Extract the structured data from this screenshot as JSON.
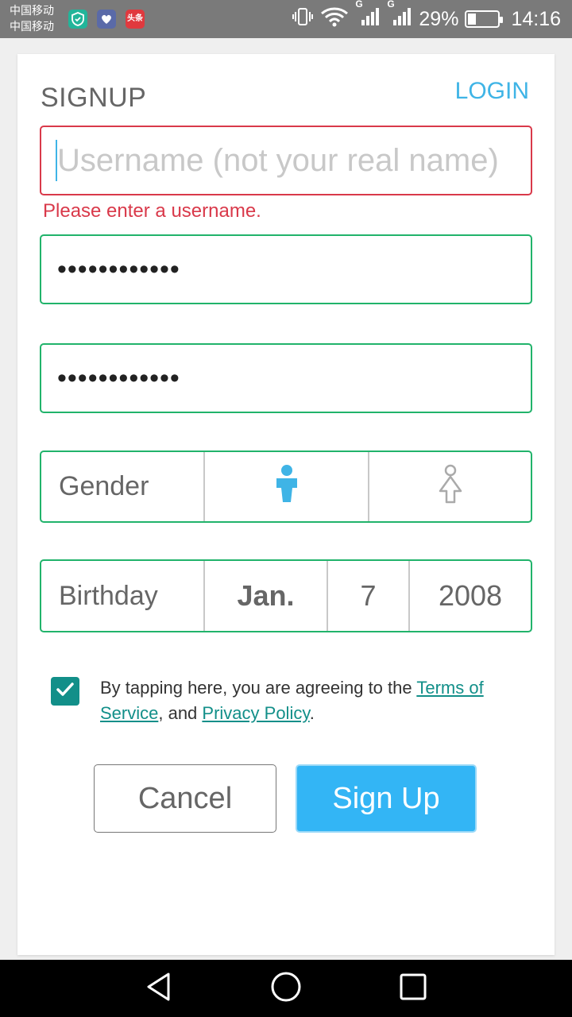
{
  "status_bar": {
    "carrier_1": "中国移动",
    "carrier_2": "中国移动",
    "app_icons": [
      "shield-icon",
      "health-icon",
      "news-icon"
    ],
    "news_icon_text": "头条",
    "signal_label_1": "G",
    "signal_label_2": "G",
    "battery_percent": "29%",
    "battery_level": 0.29,
    "time": "14:16"
  },
  "form": {
    "title": "SIGNUP",
    "login_link": "LOGIN",
    "username": {
      "placeholder": "Username (not your real name)",
      "value": "",
      "error": "Please enter a username."
    },
    "password": {
      "value": "••••••••••••"
    },
    "confirm_password": {
      "value": "••••••••••••"
    },
    "gender": {
      "label": "Gender",
      "selected": "male",
      "options": [
        "male-icon",
        "female-icon"
      ]
    },
    "birthday": {
      "label": "Birthday",
      "month": "Jan.",
      "day": "7",
      "year": "2008"
    },
    "consent": {
      "checked": true,
      "text_before": "By tapping here, you are agreeing to the ",
      "terms_link": "Terms of Service",
      "text_middle": ", and ",
      "privacy_link": "Privacy Policy",
      "text_after": "."
    },
    "cancel_label": "Cancel",
    "signup_label": "Sign Up"
  },
  "colors": {
    "accent_blue": "#33b5f5",
    "valid_green": "#21b36b",
    "error_red": "#d9394a",
    "checkbox_teal": "#128f89"
  },
  "nav_bar": {
    "buttons": [
      "back-icon",
      "home-icon",
      "recents-icon"
    ]
  }
}
